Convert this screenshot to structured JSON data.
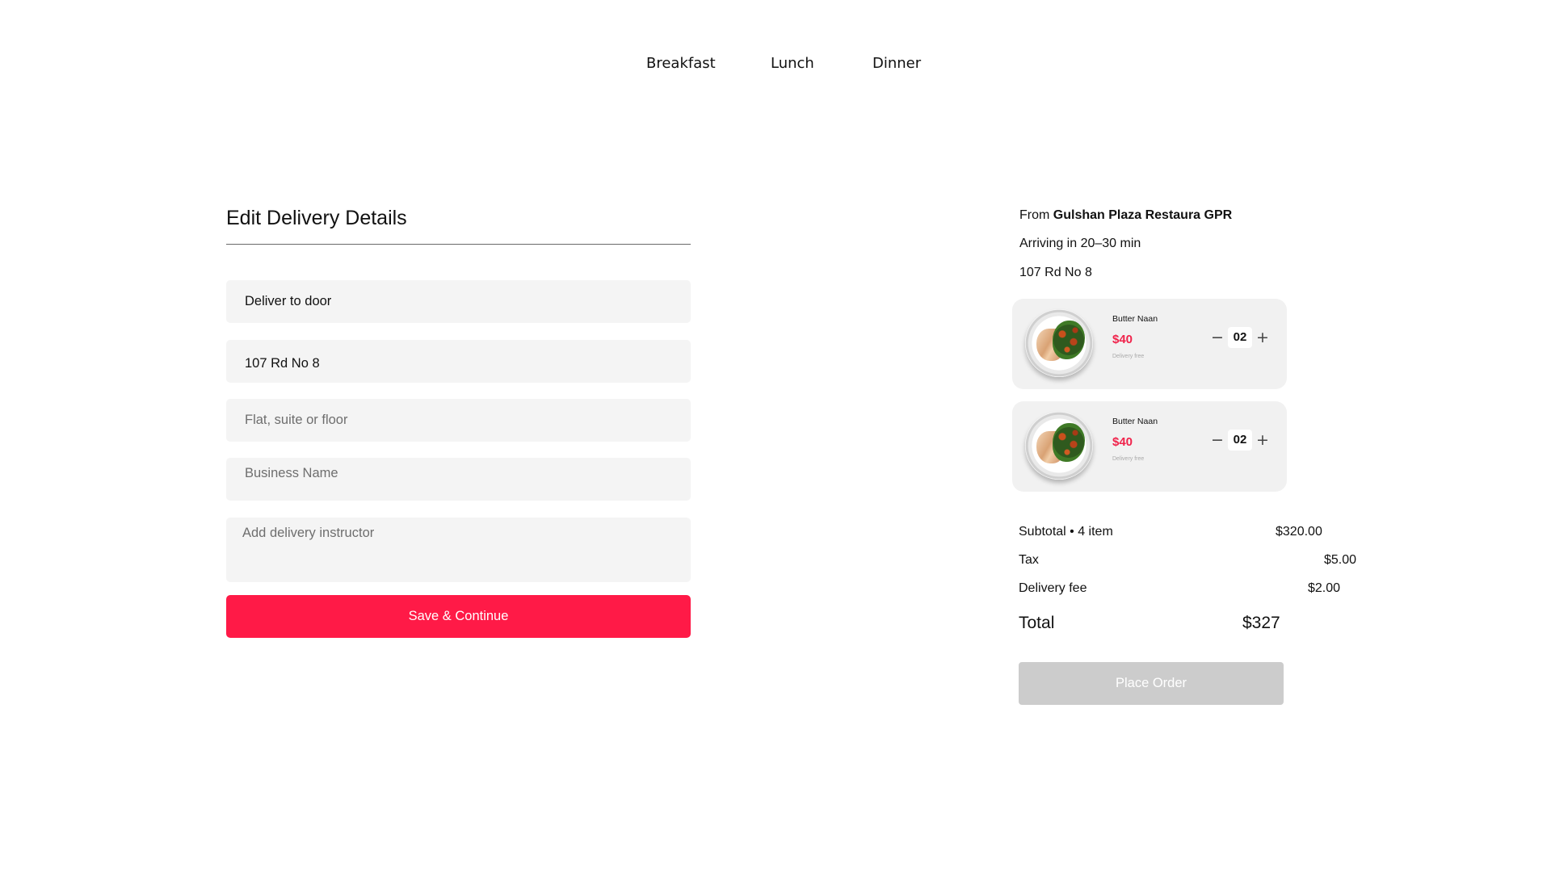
{
  "nav": {
    "items": [
      "Breakfast",
      "Lunch",
      "Dinner"
    ]
  },
  "form": {
    "title": "Edit Delivery Details",
    "delivery_option_value": "Deliver to door",
    "address_value": "107 Rd No 8",
    "flat_placeholder": "Flat, suite or floor",
    "business_placeholder": "Business Name",
    "instructions_placeholder": "Add delivery instructor",
    "save_label": "Save & Continue"
  },
  "summary": {
    "from_prefix": "From ",
    "restaurant": "Gulshan Plaza Restaura GPR",
    "arrival": "Arriving in 20–30 min",
    "address": "107 Rd No 8",
    "items": [
      {
        "name": "Butter Naan",
        "price": "$40",
        "note": "Delivery free",
        "quantity": "02",
        "minus": "−",
        "plus": "+"
      },
      {
        "name": "Butter Naan",
        "price": "$40",
        "note": "Delivery free",
        "quantity": "02",
        "minus": "−",
        "plus": "+"
      }
    ],
    "subtotal_label": "Subtotal • 4 item",
    "subtotal_value": "$320.00",
    "tax_label": "Tax",
    "tax_value": "$5.00",
    "delivery_fee_label": "Delivery fee",
    "delivery_fee_value": "$2.00",
    "total_label": "Total",
    "total_value": "$327",
    "place_order_label": "Place Order"
  },
  "colors": {
    "accent": "#ff1a47",
    "price": "#f0234b",
    "disabled_button": "#cccccc",
    "field_bg": "#f4f4f4",
    "card_bg": "#f1f1f1"
  }
}
